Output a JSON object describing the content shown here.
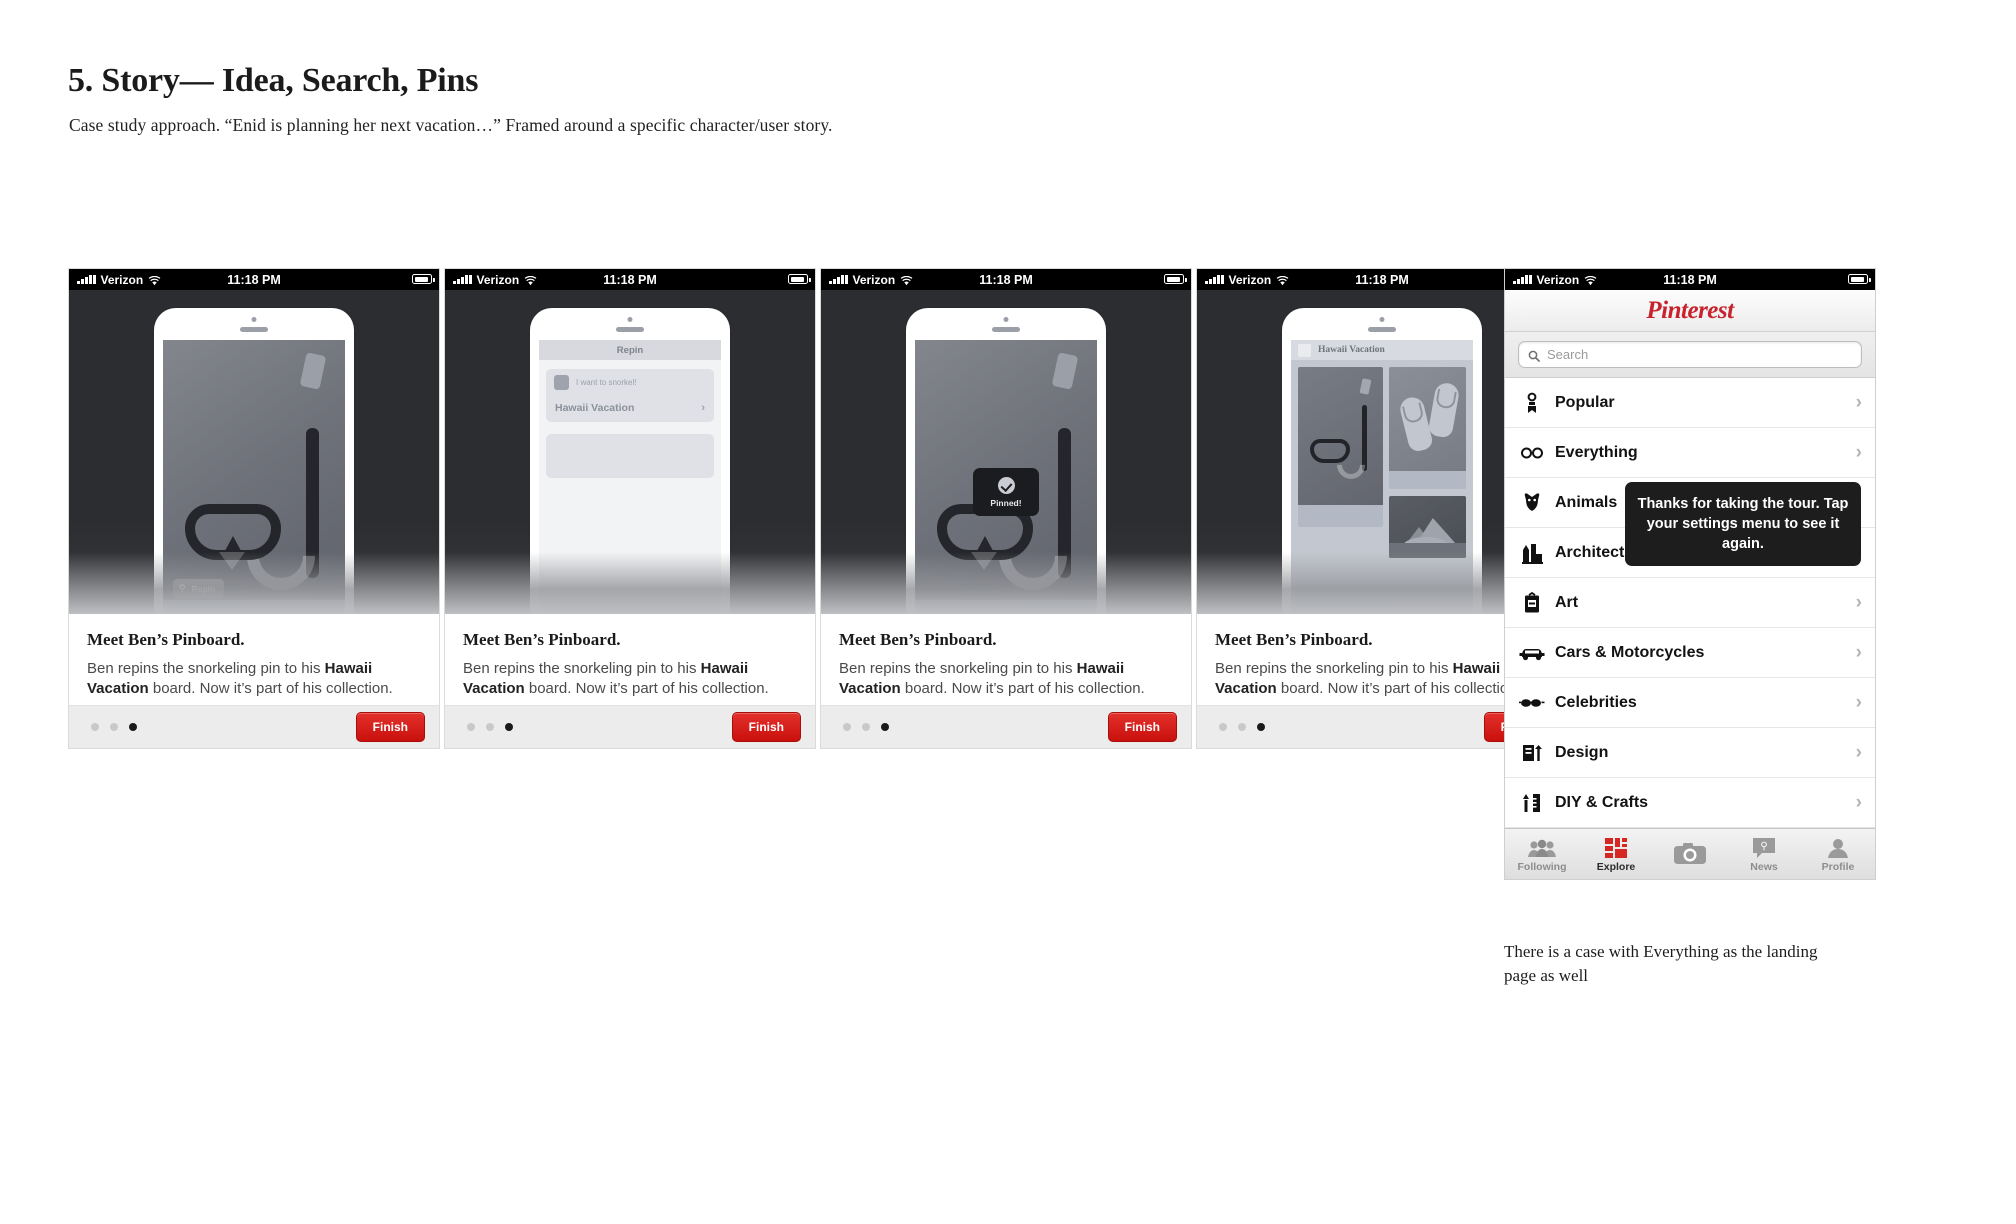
{
  "slide": {
    "title": "5. Story— Idea, Search, Pins",
    "subtitle": "Case study approach. “Enid is planning her next vacation…” Framed around a specific character/user story."
  },
  "status_bar": {
    "carrier": "Verizon",
    "time": "11:18 PM",
    "signal_icon": "signal-bars-icon",
    "wifi_icon": "wifi-icon",
    "battery_icon": "battery-icon"
  },
  "caption": {
    "title": "Meet Ben’s Pinboard.",
    "line1": "Ben repins the snorkeling pin to his",
    "board": "Hawaii Vacation",
    "line2": "board. Now it’s",
    "line3": "part of his collection."
  },
  "footer": {
    "finish_label": "Finish",
    "dots": [
      "off",
      "off",
      "on"
    ]
  },
  "panels": [
    {
      "name": "pin-detail",
      "repin_chip_label": "Repin",
      "pin_icon": "pushpin-icon"
    },
    {
      "name": "repin-form",
      "navbar_title": "Repin",
      "note_value": "I want to snorkel!",
      "board_name": "Hawaii Vacation",
      "chevron_icon": "chevron-right-icon"
    },
    {
      "name": "pinned-confirmation",
      "toast_label": "Pinned!",
      "check_icon": "check-circle-icon"
    },
    {
      "name": "board-grid",
      "board_title": "Hawaii Vacation",
      "pins": [
        "snorkel-mask",
        "flip-flops",
        "island-mountain"
      ]
    }
  ],
  "explore": {
    "logo": "Pinterest",
    "logo_color": "#c8232c",
    "search": {
      "placeholder": "Search",
      "icon": "search-icon"
    },
    "categories": [
      {
        "label": "Popular",
        "icon": "ribbon-icon"
      },
      {
        "label": "Everything",
        "icon": "infinity-icon"
      },
      {
        "label": "Animals",
        "icon": "animal-face-icon"
      },
      {
        "label": "Architecture",
        "icon": "buildings-icon"
      },
      {
        "label": "Art",
        "icon": "framed-art-icon"
      },
      {
        "label": "Cars & Motorcycles",
        "icon": "car-icon"
      },
      {
        "label": "Celebrities",
        "icon": "sunglasses-icon"
      },
      {
        "label": "Design",
        "icon": "design-icon"
      },
      {
        "label": "DIY & Crafts",
        "icon": "scissors-ruler-icon"
      }
    ],
    "chevron_icon": "chevron-right-icon",
    "tooltip": "Thanks for taking the tour. Tap your settings menu to see it again.",
    "tabs": [
      {
        "label": "Following",
        "icon": "people-icon",
        "active": false
      },
      {
        "label": "Explore",
        "icon": "grid-icon",
        "active": true
      },
      {
        "label": "",
        "icon": "camera-icon",
        "active": false
      },
      {
        "label": "News",
        "icon": "news-pin-icon",
        "active": false
      },
      {
        "label": "Profile",
        "icon": "person-icon",
        "active": false
      }
    ]
  },
  "footnote": "There is a case with Everything as the landing page as well"
}
